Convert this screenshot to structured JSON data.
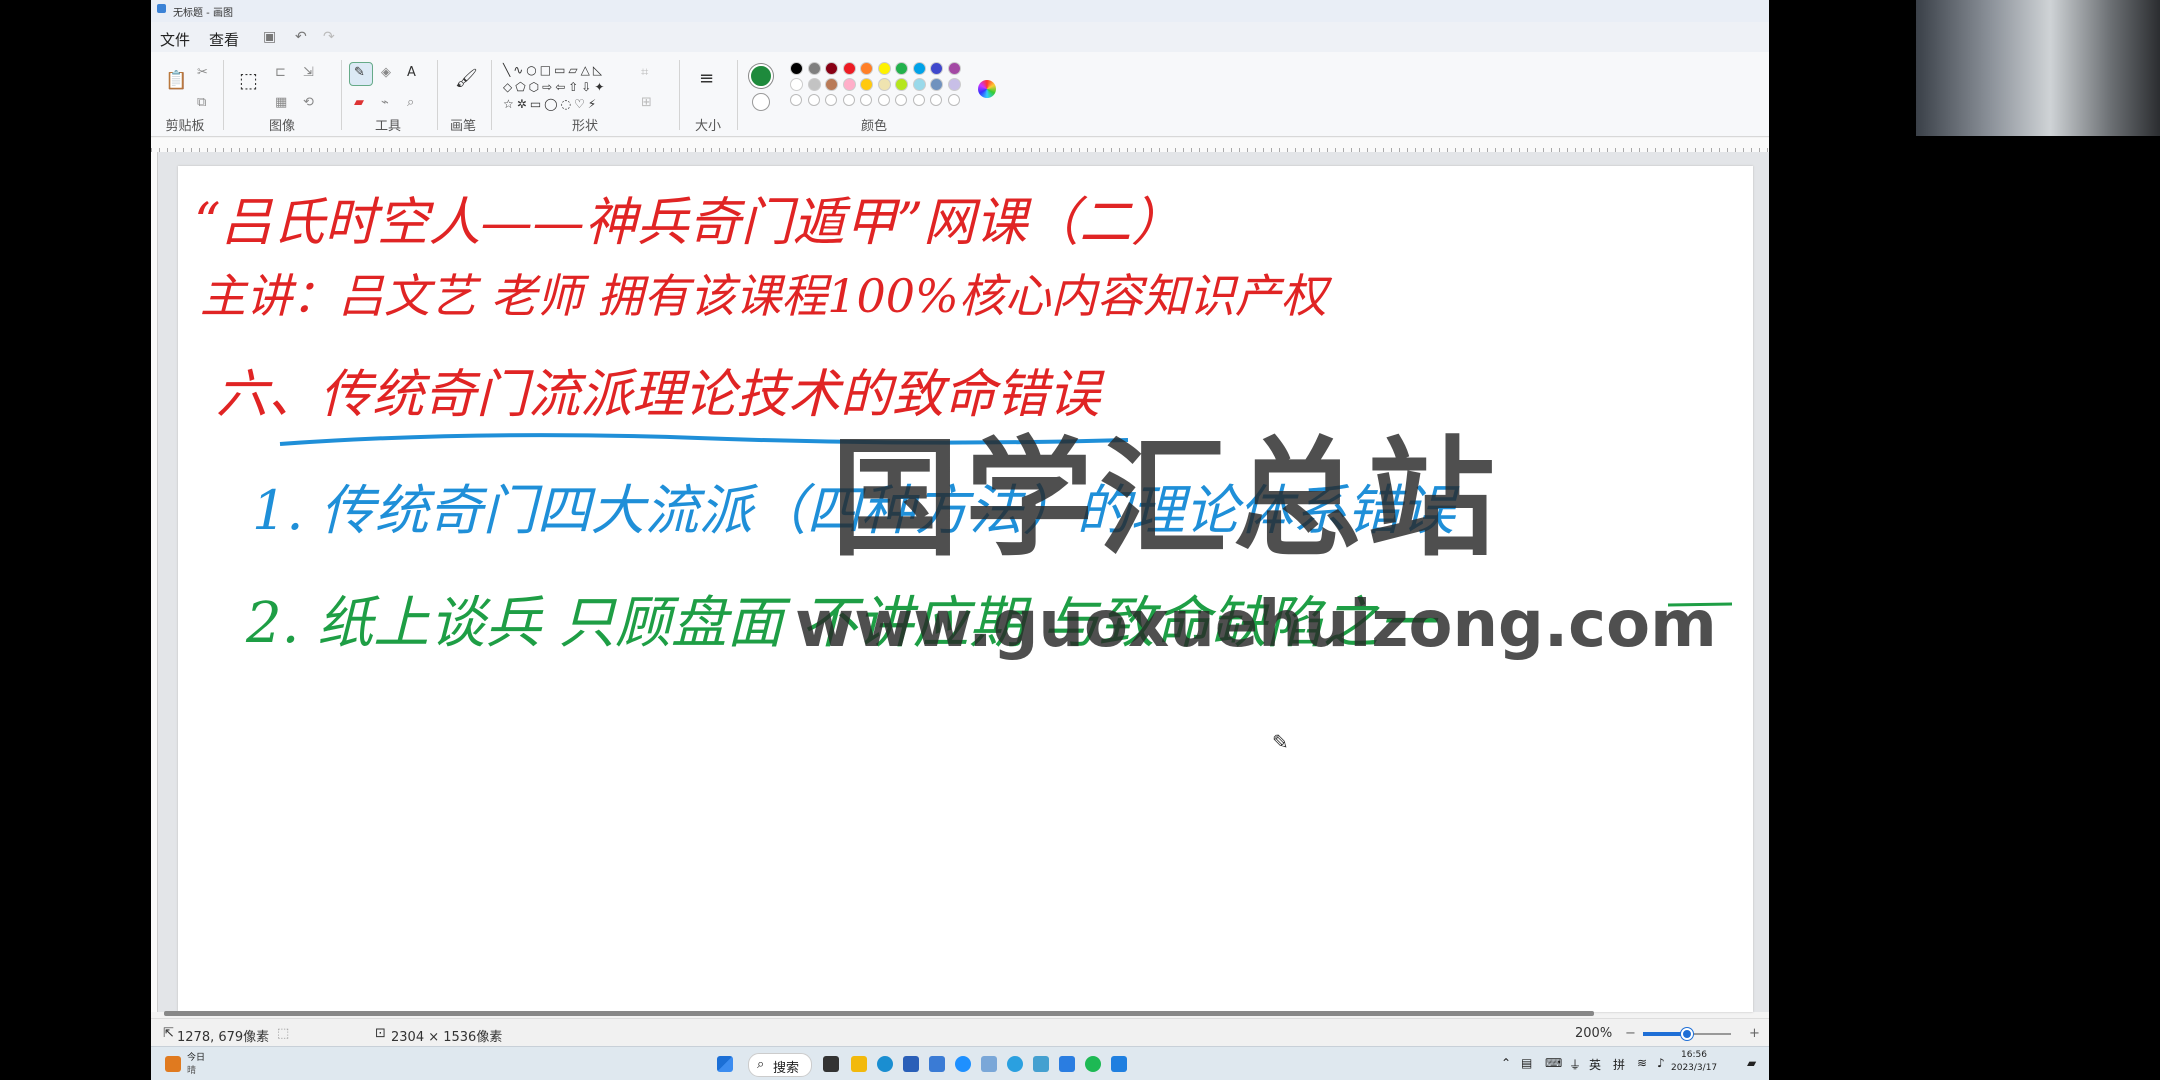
{
  "window": {
    "title": "无标题 - 画图"
  },
  "menu": {
    "file": "文件",
    "view": "查看"
  },
  "ribbon": {
    "groups": {
      "clipboard": "剪贴板",
      "image": "图像",
      "tools": "工具",
      "brush": "画笔",
      "shapes": "形状",
      "size": "大小",
      "colors": "颜色"
    },
    "colors_row1": [
      "#000000",
      "#7f7f7f",
      "#880015",
      "#ed1c24",
      "#ff7f27",
      "#fff200",
      "#22b14c",
      "#00a2e8",
      "#3f48cc",
      "#a349a4"
    ],
    "colors_row2": [
      "#ffffff",
      "#c3c3c3",
      "#b97a57",
      "#ffaec9",
      "#ffc90e",
      "#efe4b0",
      "#b5e61d",
      "#99d9ea",
      "#7092be",
      "#c8bfe7"
    ],
    "primary_color": "#1e8a3c",
    "secondary_color": "#ffffff"
  },
  "canvas_text": {
    "line1": "“吕氏时空人——神兵奇门遁甲”网课（二）",
    "line2": "主讲：吕文艺 老师 拥有该课程100%核心内容知识产权",
    "line3": "六、传统奇门流派理论技术的致命错误",
    "line4": "1. 传统奇门四大流派（四种方法）的理论体系错误",
    "line5": "2. 纸上谈兵 只顾盘面 不讲应期 与致命缺陷之一"
  },
  "watermark": {
    "title": "国学汇总站",
    "url": "www.guoxuehuizong.com"
  },
  "status": {
    "cursor": "1278, 679像素",
    "size": "2304 × 1536像素",
    "zoom": "200%"
  },
  "taskbar": {
    "weather_temp": "今日",
    "weather_desc": "晴",
    "search": "搜索",
    "ime1": "英",
    "ime2": "拼",
    "time": "16:56",
    "date": "2023/3/17"
  }
}
